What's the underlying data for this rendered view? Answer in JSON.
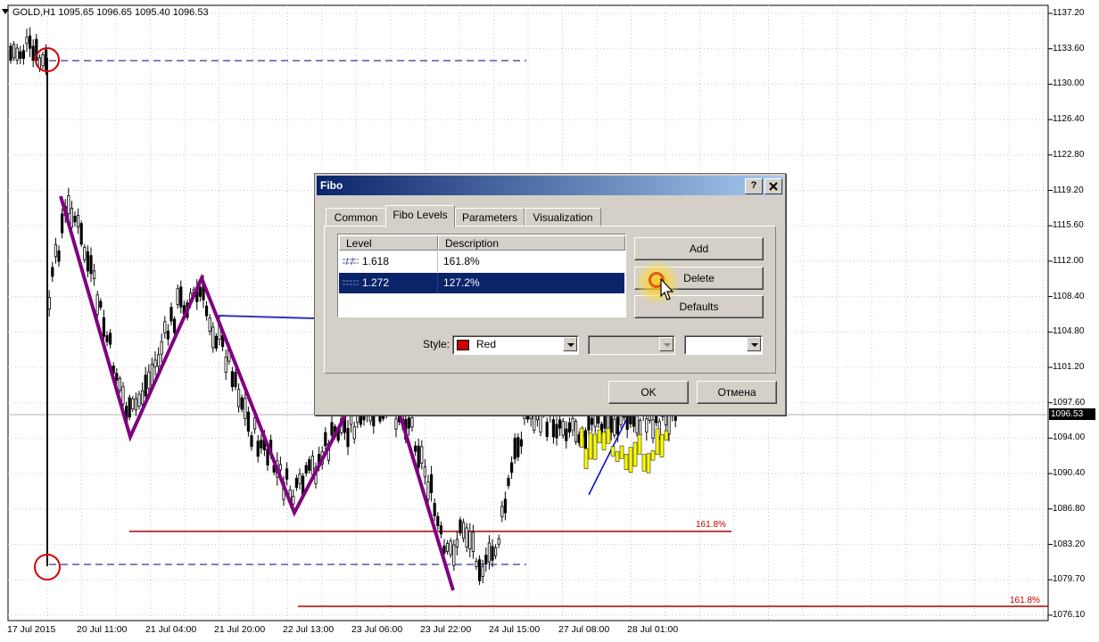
{
  "chart": {
    "symbol_info": "GOLD,H1  1095.65 1096.65 1095.40 1096.53",
    "current_price": "1096.53",
    "price_ticks": [
      "1137.20",
      "1133.60",
      "1130.00",
      "1126.40",
      "1122.80",
      "1119.20",
      "1115.60",
      "1112.00",
      "1108.40",
      "1104.80",
      "1101.20",
      "1097.60",
      "1094.00",
      "1090.40",
      "1086.80",
      "1083.20",
      "1079.70",
      "1076.10"
    ],
    "time_ticks": [
      "17 Jul 2015",
      "20 Jul 11:00",
      "21 Jul 04:00",
      "21 Jul 20:00",
      "22 Jul 13:00",
      "23 Jul 06:00",
      "23 Jul 22:00",
      "24 Jul 15:00",
      "27 Jul 08:00",
      "28 Jul 01:00"
    ],
    "fibo_labels": [
      "161.8%",
      "161.8%"
    ],
    "colors": {
      "candles": "#000000",
      "zigzag": "#800080",
      "fibo": "#b00000",
      "dashed": "#000080",
      "circles": "#d00000",
      "highlight": "#ffff00",
      "trend": "#0000cc"
    }
  },
  "dialog": {
    "title": "Fibo",
    "help_label": "?",
    "close_label": "X",
    "tabs": [
      "Common",
      "Fibo Levels",
      "Parameters",
      "Visualization"
    ],
    "active_tab": "Fibo Levels",
    "columns": [
      "Level",
      "Description"
    ],
    "rows": [
      {
        "level": "1.618",
        "description": "161.8%"
      },
      {
        "level": "1.272",
        "description": "127.2%"
      }
    ],
    "selected_row": 1,
    "buttons": {
      "add": "Add",
      "delete": "Delete",
      "defaults": "Defaults",
      "ok": "OK",
      "cancel": "Отмена"
    },
    "style_label": "Style:",
    "color_value": "Red"
  }
}
